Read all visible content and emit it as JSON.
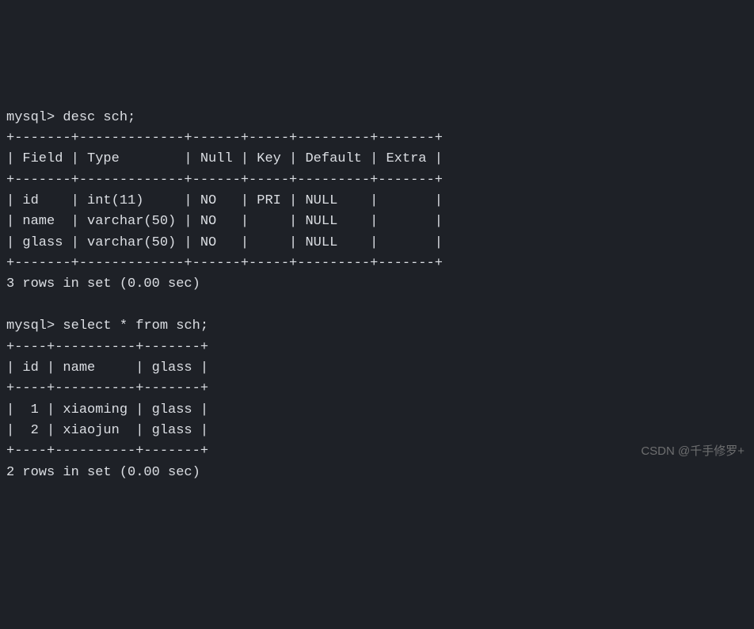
{
  "prompt": "mysql>",
  "query1": {
    "command": "desc sch;",
    "table": {
      "border_top": "+-------+-------------+------+-----+---------+-------+",
      "header": "| Field | Type        | Null | Key | Default | Extra |",
      "border_mid": "+-------+-------------+------+-----+---------+-------+",
      "rows": [
        "| id    | int(11)     | NO   | PRI | NULL    |       |",
        "| name  | varchar(50) | NO   |     | NULL    |       |",
        "| glass | varchar(50) | NO   |     | NULL    |       |"
      ],
      "border_bot": "+-------+-------------+------+-----+---------+-------+"
    },
    "status": "3 rows in set (0.00 sec)"
  },
  "query2": {
    "command": "select * from sch;",
    "table": {
      "border_top": "+----+----------+-------+",
      "header": "| id | name     | glass |",
      "border_mid": "+----+----------+-------+",
      "rows": [
        "|  1 | xiaoming | glass |",
        "|  2 | xiaojun  | glass |"
      ],
      "border_bot": "+----+----------+-------+"
    },
    "status": "2 rows in set (0.00 sec)"
  },
  "watermark": "CSDN @千手修罗+"
}
